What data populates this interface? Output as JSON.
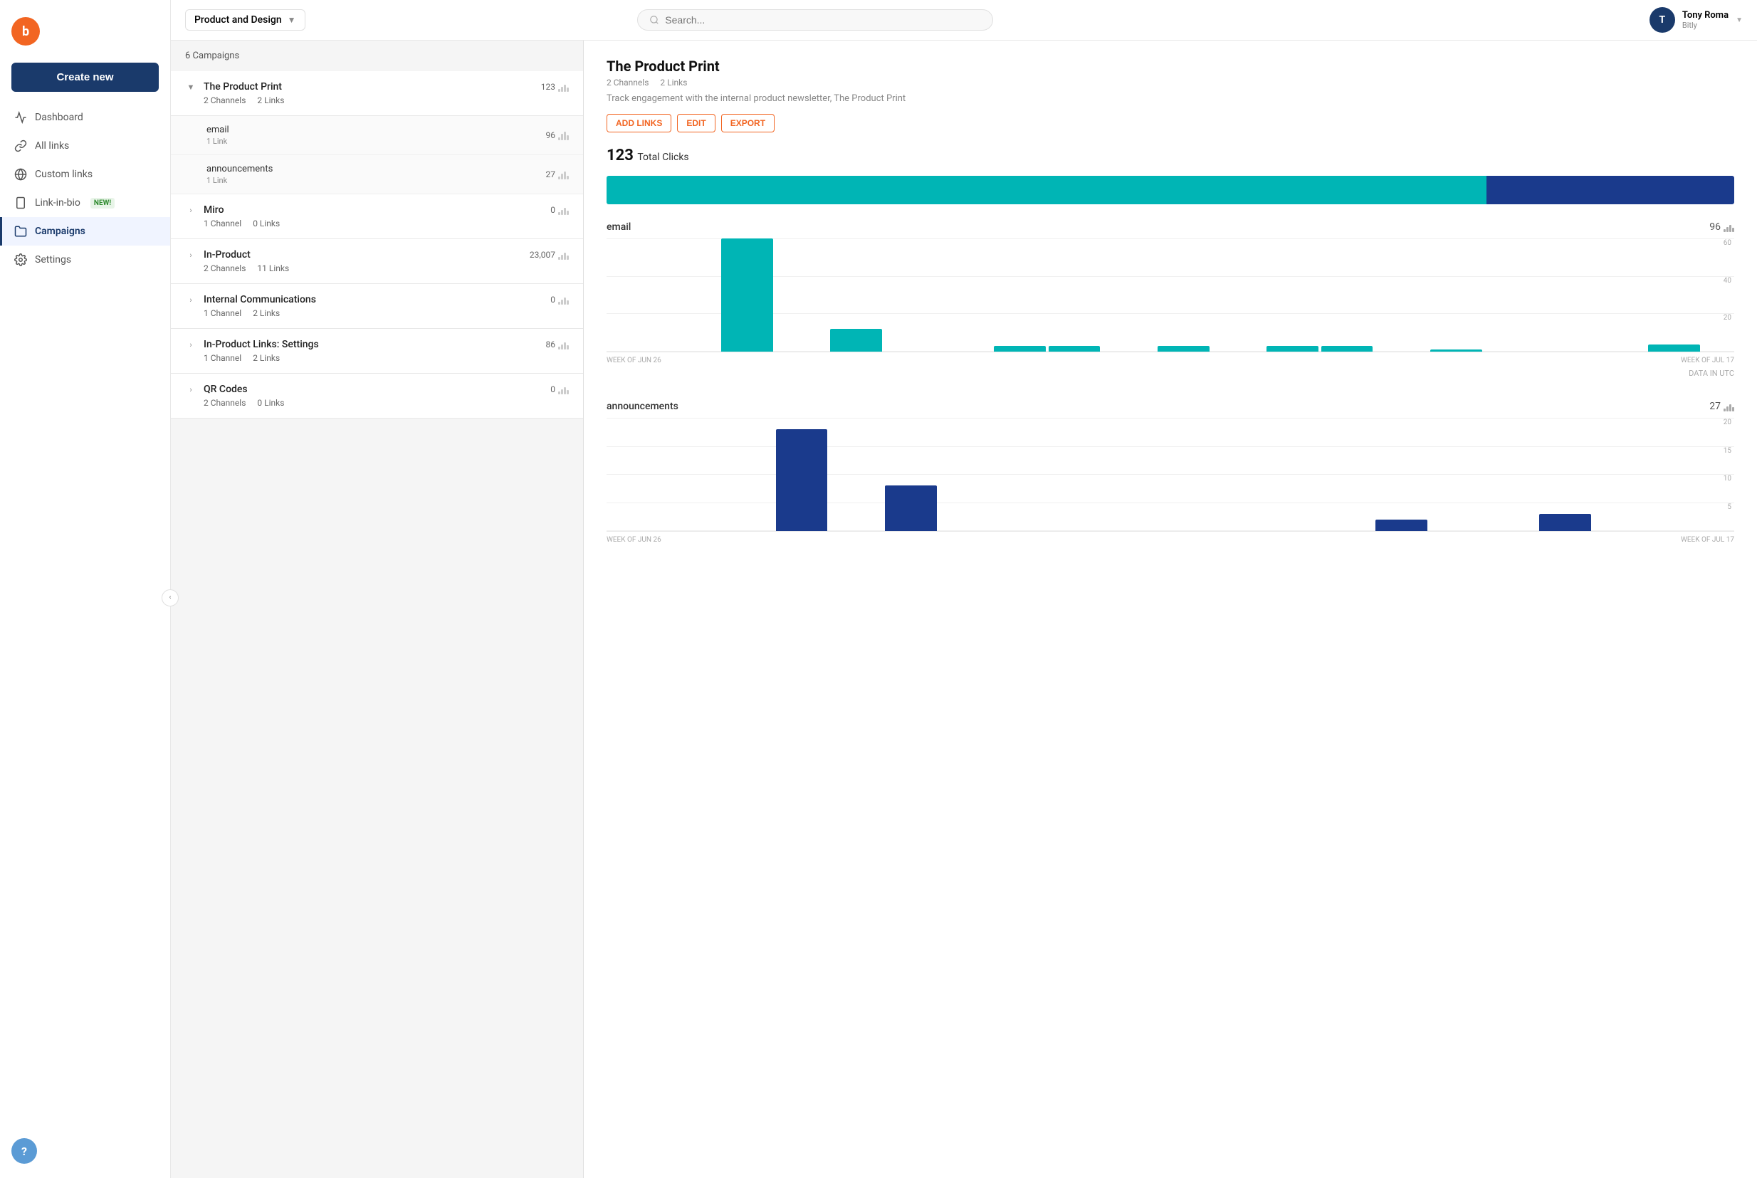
{
  "app": {
    "logo_text": "b",
    "logo_bg": "#f26522"
  },
  "sidebar": {
    "create_new": "Create new",
    "nav_items": [
      {
        "id": "dashboard",
        "label": "Dashboard",
        "icon": "chart-line",
        "active": false
      },
      {
        "id": "all-links",
        "label": "All links",
        "icon": "link",
        "active": false
      },
      {
        "id": "custom-links",
        "label": "Custom links",
        "icon": "globe",
        "active": false
      },
      {
        "id": "link-in-bio",
        "label": "Link-in-bio",
        "icon": "phone",
        "active": false,
        "badge": "NEW!"
      },
      {
        "id": "campaigns",
        "label": "Campaigns",
        "icon": "folder",
        "active": true
      },
      {
        "id": "settings",
        "label": "Settings",
        "icon": "gear",
        "active": false
      }
    ],
    "help_label": "?"
  },
  "topbar": {
    "workspace": "Product and Design",
    "search_placeholder": "Search...",
    "user_name": "Tony Roma",
    "user_org": "Bitly",
    "user_initial": "T"
  },
  "campaign_list": {
    "count_label": "6 Campaigns",
    "campaigns": [
      {
        "id": "product-print",
        "name": "The Product Print",
        "channels": "2 Channels",
        "links": "2 Links",
        "clicks": "123",
        "expanded": true,
        "sub_items": [
          {
            "name": "email",
            "links": "1 Link",
            "clicks": "96"
          },
          {
            "name": "announcements",
            "links": "1 Link",
            "clicks": "27"
          }
        ]
      },
      {
        "id": "miro",
        "name": "Miro",
        "channels": "1 Channel",
        "links": "0 Links",
        "clicks": "0",
        "expanded": false
      },
      {
        "id": "in-product",
        "name": "In-Product",
        "channels": "2 Channels",
        "links": "11 Links",
        "clicks": "23,007",
        "expanded": false
      },
      {
        "id": "internal-comms",
        "name": "Internal Communications",
        "channels": "1 Channel",
        "links": "2 Links",
        "clicks": "0",
        "expanded": false
      },
      {
        "id": "in-product-settings",
        "name": "In-Product Links: Settings",
        "channels": "1 Channel",
        "links": "2 Links",
        "clicks": "86",
        "expanded": false
      },
      {
        "id": "qr-codes",
        "name": "QR Codes",
        "channels": "2 Channels",
        "links": "0 Links",
        "clicks": "0",
        "expanded": false
      }
    ]
  },
  "detail": {
    "title": "The Product Print",
    "channels": "2 Channels",
    "links": "2 Links",
    "description": "Track engagement with the internal product newsletter, The Product Print",
    "btn_add_links": "ADD LINKS",
    "btn_edit": "EDIT",
    "btn_export": "EXPORT",
    "total_clicks": "123",
    "total_clicks_label": "Total Clicks",
    "progress_teal_pct": 78,
    "progress_blue_pct": 22,
    "email_section": {
      "label": "email",
      "count": "96",
      "week_labels": [
        "WEEK OF JUN 26",
        "WEEK OF JUL 17"
      ],
      "grid_labels": [
        "60",
        "40",
        "20"
      ],
      "bars": [
        0,
        0,
        100,
        0,
        20,
        0,
        0,
        5,
        5,
        0,
        5,
        0,
        5,
        5,
        0,
        2,
        0,
        0,
        0,
        6
      ],
      "bar_color": "#00b5b5",
      "data_utc": "DATA IN UTC"
    },
    "announcements_section": {
      "label": "announcements",
      "count": "27",
      "week_labels": [
        "WEEK OF JUN 26",
        "WEEK OF JUL 17"
      ],
      "grid_labels": [
        "20",
        "15",
        "10",
        "5"
      ],
      "bars": [
        0,
        0,
        0,
        18,
        0,
        8,
        0,
        0,
        0,
        0,
        0,
        0,
        0,
        0,
        2,
        0,
        0,
        3,
        0,
        0
      ],
      "bar_color": "#1a3a8c"
    }
  }
}
